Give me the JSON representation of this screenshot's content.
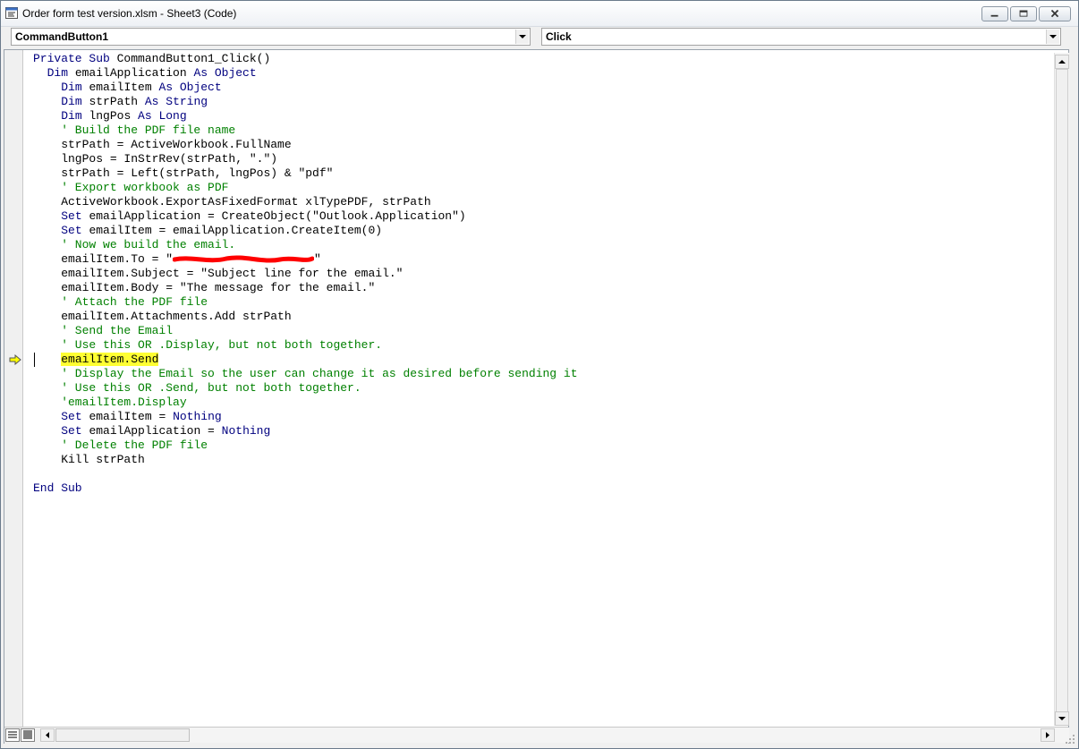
{
  "window": {
    "title": "Order form test version.xlsm - Sheet3 (Code)",
    "icon": "vba-code-window-icon"
  },
  "object_combo": {
    "value": "CommandButton1"
  },
  "procedure_combo": {
    "value": "Click"
  },
  "code": {
    "lines": [
      {
        "parts": [
          {
            "t": "Private Sub ",
            "c": "kw"
          },
          {
            "t": "CommandButton1_Click()",
            "c": ""
          }
        ]
      },
      {
        "parts": [
          {
            "t": "  ",
            "c": ""
          },
          {
            "t": "Dim ",
            "c": "kw"
          },
          {
            "t": "emailApplication ",
            "c": ""
          },
          {
            "t": "As Object",
            "c": "kw"
          }
        ]
      },
      {
        "parts": [
          {
            "t": "    ",
            "c": ""
          },
          {
            "t": "Dim ",
            "c": "kw"
          },
          {
            "t": "emailItem ",
            "c": ""
          },
          {
            "t": "As Object",
            "c": "kw"
          }
        ]
      },
      {
        "parts": [
          {
            "t": "    ",
            "c": ""
          },
          {
            "t": "Dim ",
            "c": "kw"
          },
          {
            "t": "strPath ",
            "c": ""
          },
          {
            "t": "As String",
            "c": "kw"
          }
        ]
      },
      {
        "parts": [
          {
            "t": "    ",
            "c": ""
          },
          {
            "t": "Dim ",
            "c": "kw"
          },
          {
            "t": "lngPos ",
            "c": ""
          },
          {
            "t": "As Long",
            "c": "kw"
          }
        ]
      },
      {
        "parts": [
          {
            "t": "    ' Build the PDF file name",
            "c": "cm"
          }
        ]
      },
      {
        "parts": [
          {
            "t": "    strPath = ActiveWorkbook.FullName",
            "c": ""
          }
        ]
      },
      {
        "parts": [
          {
            "t": "    lngPos = InStrRev(strPath, \".\")",
            "c": ""
          }
        ]
      },
      {
        "parts": [
          {
            "t": "    strPath = Left(strPath, lngPos) & \"pdf\"",
            "c": ""
          }
        ]
      },
      {
        "parts": [
          {
            "t": "    ' Export workbook as PDF",
            "c": "cm"
          }
        ]
      },
      {
        "parts": [
          {
            "t": "    ActiveWorkbook.ExportAsFixedFormat xlTypePDF, strPath",
            "c": ""
          }
        ]
      },
      {
        "parts": [
          {
            "t": "    ",
            "c": ""
          },
          {
            "t": "Set ",
            "c": "kw"
          },
          {
            "t": "emailApplication = CreateObject(\"Outlook.Application\")",
            "c": ""
          }
        ]
      },
      {
        "parts": [
          {
            "t": "    ",
            "c": ""
          },
          {
            "t": "Set ",
            "c": "kw"
          },
          {
            "t": "emailItem = emailApplication.CreateItem(0)",
            "c": ""
          }
        ]
      },
      {
        "parts": [
          {
            "t": "    ' Now we build the email.",
            "c": "cm"
          }
        ]
      },
      {
        "parts": [
          {
            "t": "    emailItem.To = \"",
            "c": ""
          },
          {
            "t": "",
            "c": "redact"
          },
          {
            "t": "\"",
            "c": ""
          }
        ]
      },
      {
        "parts": [
          {
            "t": "    emailItem.Subject = \"Subject line for the email.\"",
            "c": ""
          }
        ]
      },
      {
        "parts": [
          {
            "t": "    emailItem.Body = \"The message for the email.\"",
            "c": ""
          }
        ]
      },
      {
        "parts": [
          {
            "t": "    ' Attach the PDF file",
            "c": "cm"
          }
        ]
      },
      {
        "parts": [
          {
            "t": "    emailItem.Attachments.Add strPath",
            "c": ""
          }
        ]
      },
      {
        "parts": [
          {
            "t": "    ' Send the Email",
            "c": "cm"
          }
        ]
      },
      {
        "parts": [
          {
            "t": "    ' Use this OR .Display, but not both together.",
            "c": "cm"
          }
        ]
      },
      {
        "parts": [
          {
            "t": "    ",
            "c": ""
          },
          {
            "t": "emailItem.Send",
            "c": "hl"
          }
        ]
      },
      {
        "parts": [
          {
            "t": "    ' Display the Email so the user can change it as desired before sending it",
            "c": "cm"
          }
        ]
      },
      {
        "parts": [
          {
            "t": "    ' Use this OR .Send, but not both together.",
            "c": "cm"
          }
        ]
      },
      {
        "parts": [
          {
            "t": "    'emailItem.Display",
            "c": "cm"
          }
        ]
      },
      {
        "parts": [
          {
            "t": "    ",
            "c": ""
          },
          {
            "t": "Set ",
            "c": "kw"
          },
          {
            "t": "emailItem = ",
            "c": ""
          },
          {
            "t": "Nothing",
            "c": "kw"
          }
        ]
      },
      {
        "parts": [
          {
            "t": "    ",
            "c": ""
          },
          {
            "t": "Set ",
            "c": "kw"
          },
          {
            "t": "emailApplication = ",
            "c": ""
          },
          {
            "t": "Nothing",
            "c": "kw"
          }
        ]
      },
      {
        "parts": [
          {
            "t": "    ' Delete the PDF file",
            "c": "cm"
          }
        ]
      },
      {
        "parts": [
          {
            "t": "    Kill strPath",
            "c": ""
          }
        ]
      },
      {
        "parts": [
          {
            "t": "",
            "c": ""
          }
        ]
      },
      {
        "parts": [
          {
            "t": "End Sub",
            "c": "kw"
          }
        ]
      }
    ],
    "execution_line": 21
  },
  "colors": {
    "keyword": "#00007f",
    "comment": "#008000",
    "execution_highlight": "#ffff33",
    "redaction": "#ff0000"
  }
}
